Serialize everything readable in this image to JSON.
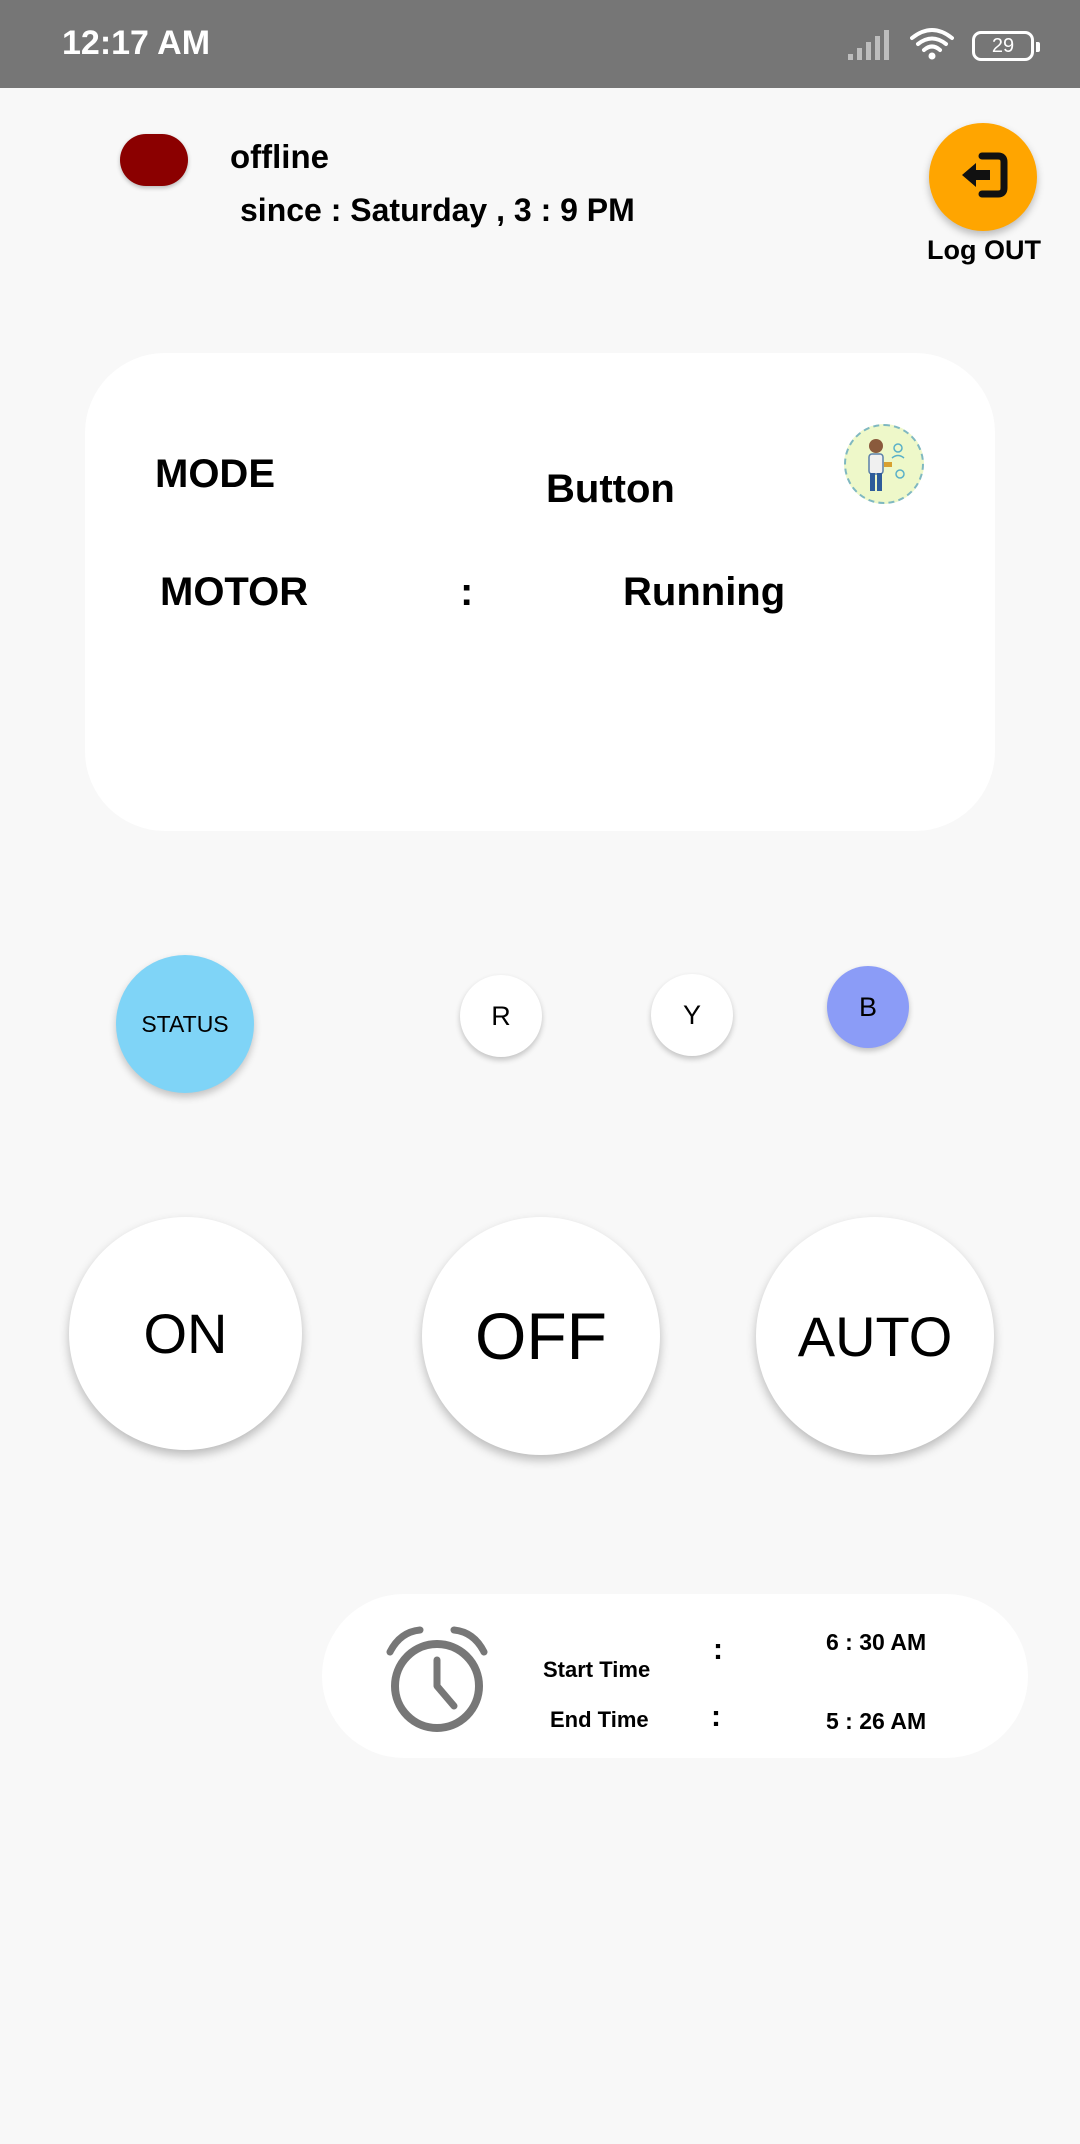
{
  "status_bar": {
    "time": "12:17 AM",
    "battery": "29",
    "icons": [
      "signal-icon",
      "wifi-icon",
      "battery-icon"
    ]
  },
  "connection": {
    "state": "offline",
    "since": "since : Saturday , 3 : 9 PM",
    "indicator_color": "#8b0000"
  },
  "logout": {
    "label": "Log OUT",
    "color": "#ffa500",
    "icon": "logout-icon"
  },
  "mode_card": {
    "mode_label": "MODE",
    "mode_value": "Button",
    "motor_label": "MOTOR",
    "separator": ":",
    "motor_value": "Running",
    "avatar_icon": "technician-avatar-icon"
  },
  "phases": {
    "status_label": "STATUS",
    "status_color": "#7fd4f7",
    "r": "R",
    "y": "Y",
    "b": "B",
    "b_color": "#8b9cf7"
  },
  "controls": {
    "on": "ON",
    "off": "OFF",
    "auto": "AUTO"
  },
  "timer": {
    "icon": "alarm-clock-icon",
    "start_label": "Start Time",
    "end_label": "End Time",
    "separator": ":",
    "start_value": "6 :  30 AM",
    "end_value": "5 :  26 AM"
  }
}
